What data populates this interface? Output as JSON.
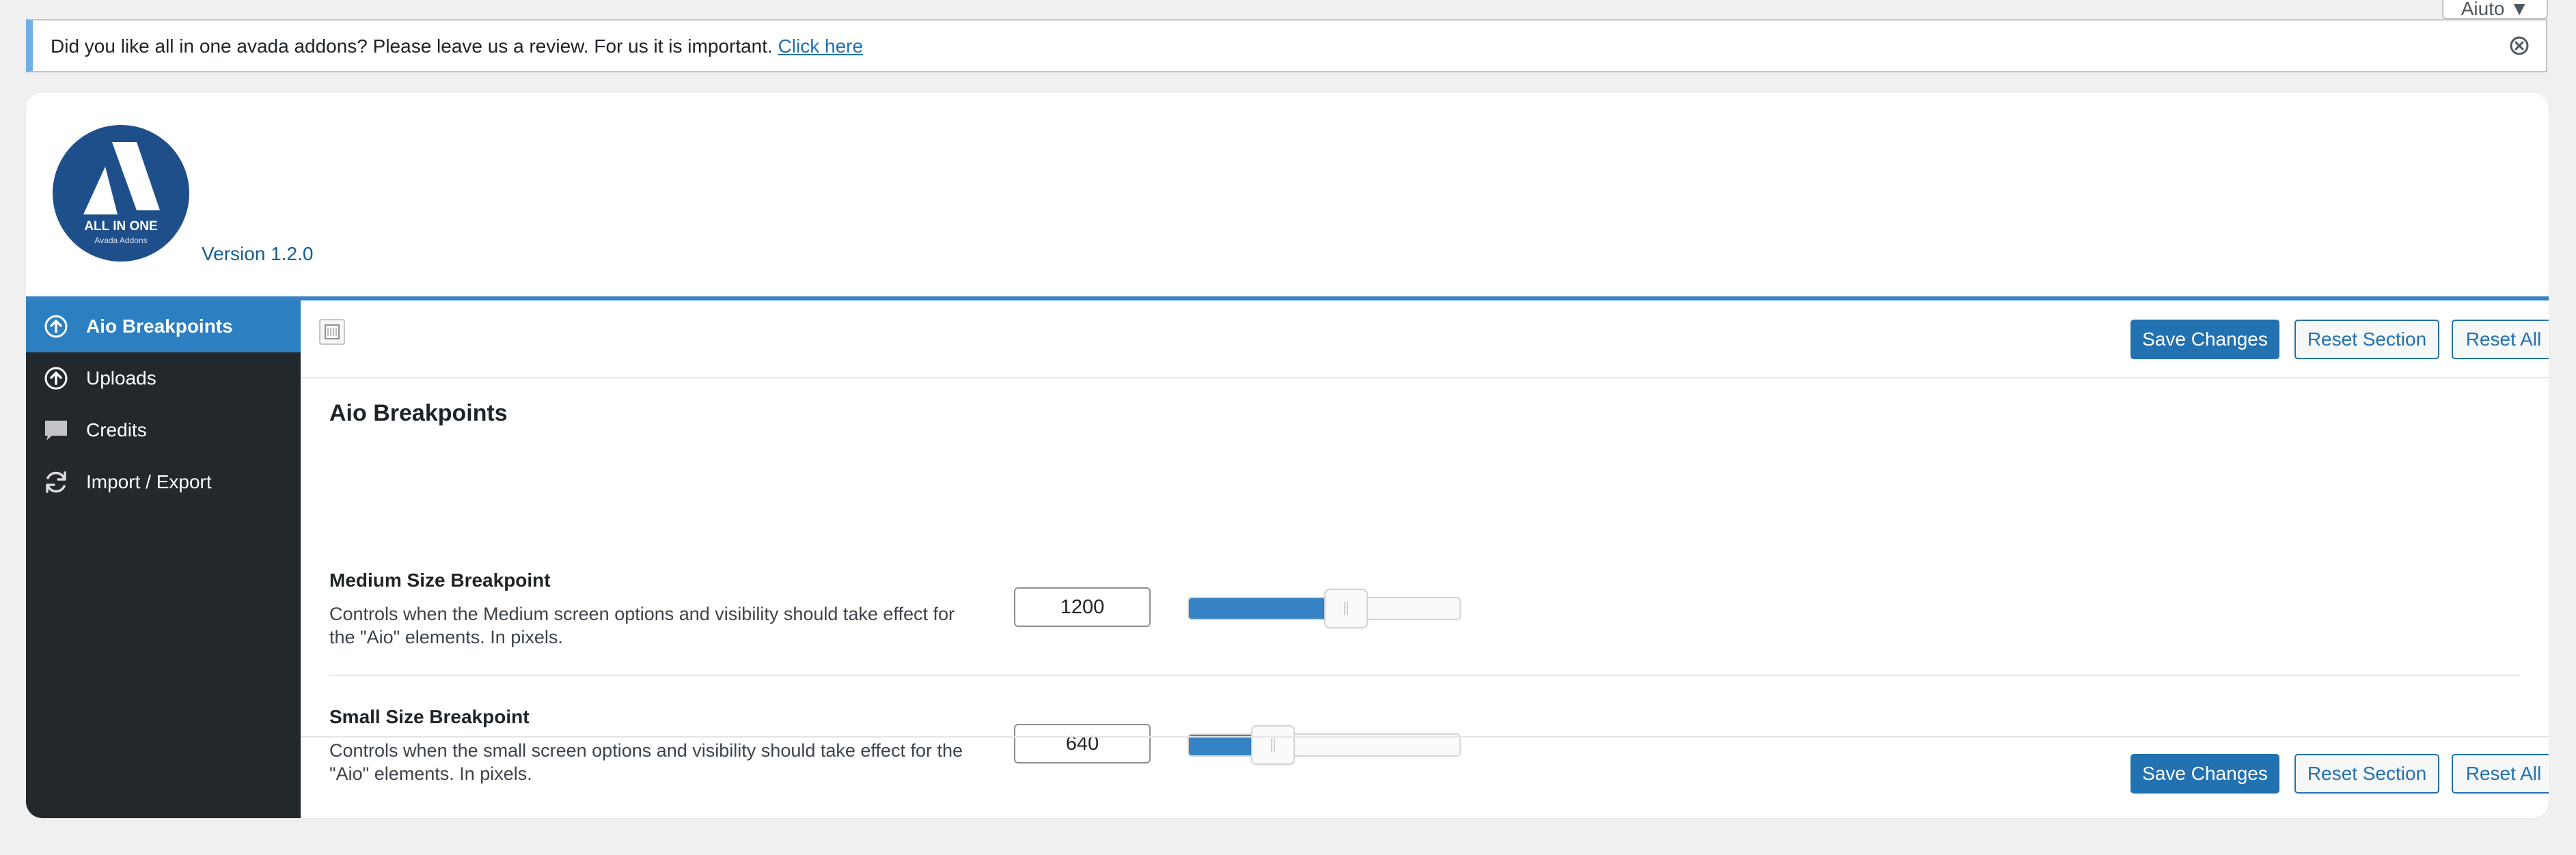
{
  "help_tab": {
    "label": "Aiuto ▼"
  },
  "notice": {
    "message": "Did you like all in one avada addons? Please leave us a review. For us it is important.",
    "link_text": "Click here"
  },
  "header": {
    "logo_title": "ALL IN ONE",
    "logo_subtitle": "Avada Addons",
    "version": "Version 1.2.0"
  },
  "sidebar": {
    "items": [
      {
        "label": "Aio Breakpoints",
        "icon": "arrow-up-circle-icon",
        "active": true
      },
      {
        "label": "Uploads",
        "icon": "arrow-up-circle-icon",
        "active": false
      },
      {
        "label": "Credits",
        "icon": "speech-bubble-icon",
        "active": false
      },
      {
        "label": "Import / Export",
        "icon": "refresh-icon",
        "active": false
      }
    ]
  },
  "toolbar": {
    "save_label": "Save Changes",
    "reset_section_label": "Reset Section",
    "reset_all_label": "Reset All"
  },
  "section": {
    "title": "Aio Breakpoints",
    "fields": [
      {
        "title": "Medium Size Breakpoint",
        "description": "Controls when the Medium screen options and visibility should take effect for the \"Aio\" elements. In pixels.",
        "value": "1200",
        "slider_fraction": 0.58
      },
      {
        "title": "Small Size Breakpoint",
        "description": "Controls when the small screen options and visibility should take effect for the \"Aio\" elements. In pixels.",
        "value": "640",
        "slider_fraction": 0.31
      }
    ]
  },
  "footer": {
    "save_label": "Save Changes",
    "reset_section_label": "Reset Section",
    "reset_all_label": "Reset All"
  },
  "colors": {
    "accent": "#2271b1",
    "sidebar_bg": "#23282d",
    "sidebar_active": "#2c7fc0",
    "notice_border": "#72aee6",
    "logo_bg": "#1f4f8a"
  }
}
